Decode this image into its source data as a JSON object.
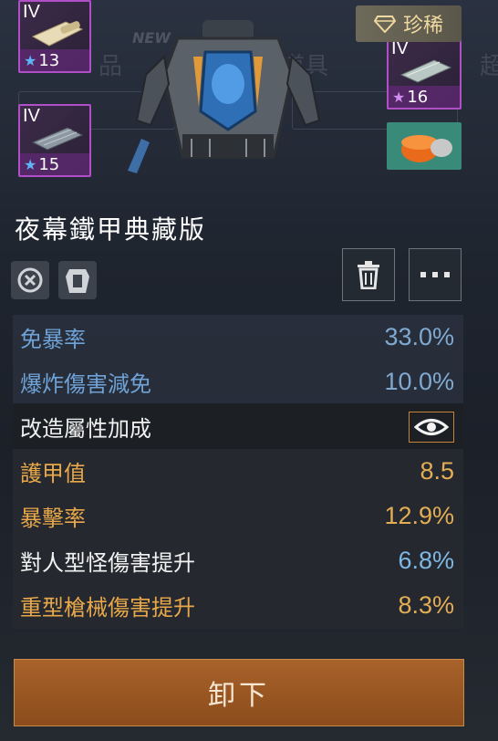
{
  "materials": [
    {
      "tier": "IV",
      "count": "13",
      "star": "blue"
    },
    {
      "tier": "IV",
      "count": "15",
      "star": "blue"
    },
    {
      "tier": "IV",
      "count": "16",
      "star": "purple"
    }
  ],
  "rarity": {
    "label": "珍稀",
    "icon": "diamond-icon"
  },
  "item": {
    "name": "夜幕鐵甲典藏版"
  },
  "stats_top": [
    {
      "label": "免暴率",
      "value": "33.0%"
    },
    {
      "label": "爆炸傷害減免",
      "value": "10.0%"
    }
  ],
  "mod_section": {
    "label": "改造屬性加成",
    "icon": "eye-icon"
  },
  "stats_mod": [
    {
      "label": "護甲值",
      "value": "8.5",
      "style": "gold"
    },
    {
      "label": "暴擊率",
      "value": "12.9%",
      "style": "gold"
    },
    {
      "label": "對人型怪傷害提升",
      "value": "6.8%",
      "style": "white"
    },
    {
      "label": "重型槍械傷害提升",
      "value": "8.3%",
      "style": "gold"
    }
  ],
  "buttons": {
    "unequip": "卸下"
  },
  "colors": {
    "accent_gold": "#e8a84a",
    "stat_blue": "#6fa2d6",
    "button_orange": "#9a5722",
    "rare_purple": "#b04fc8"
  }
}
